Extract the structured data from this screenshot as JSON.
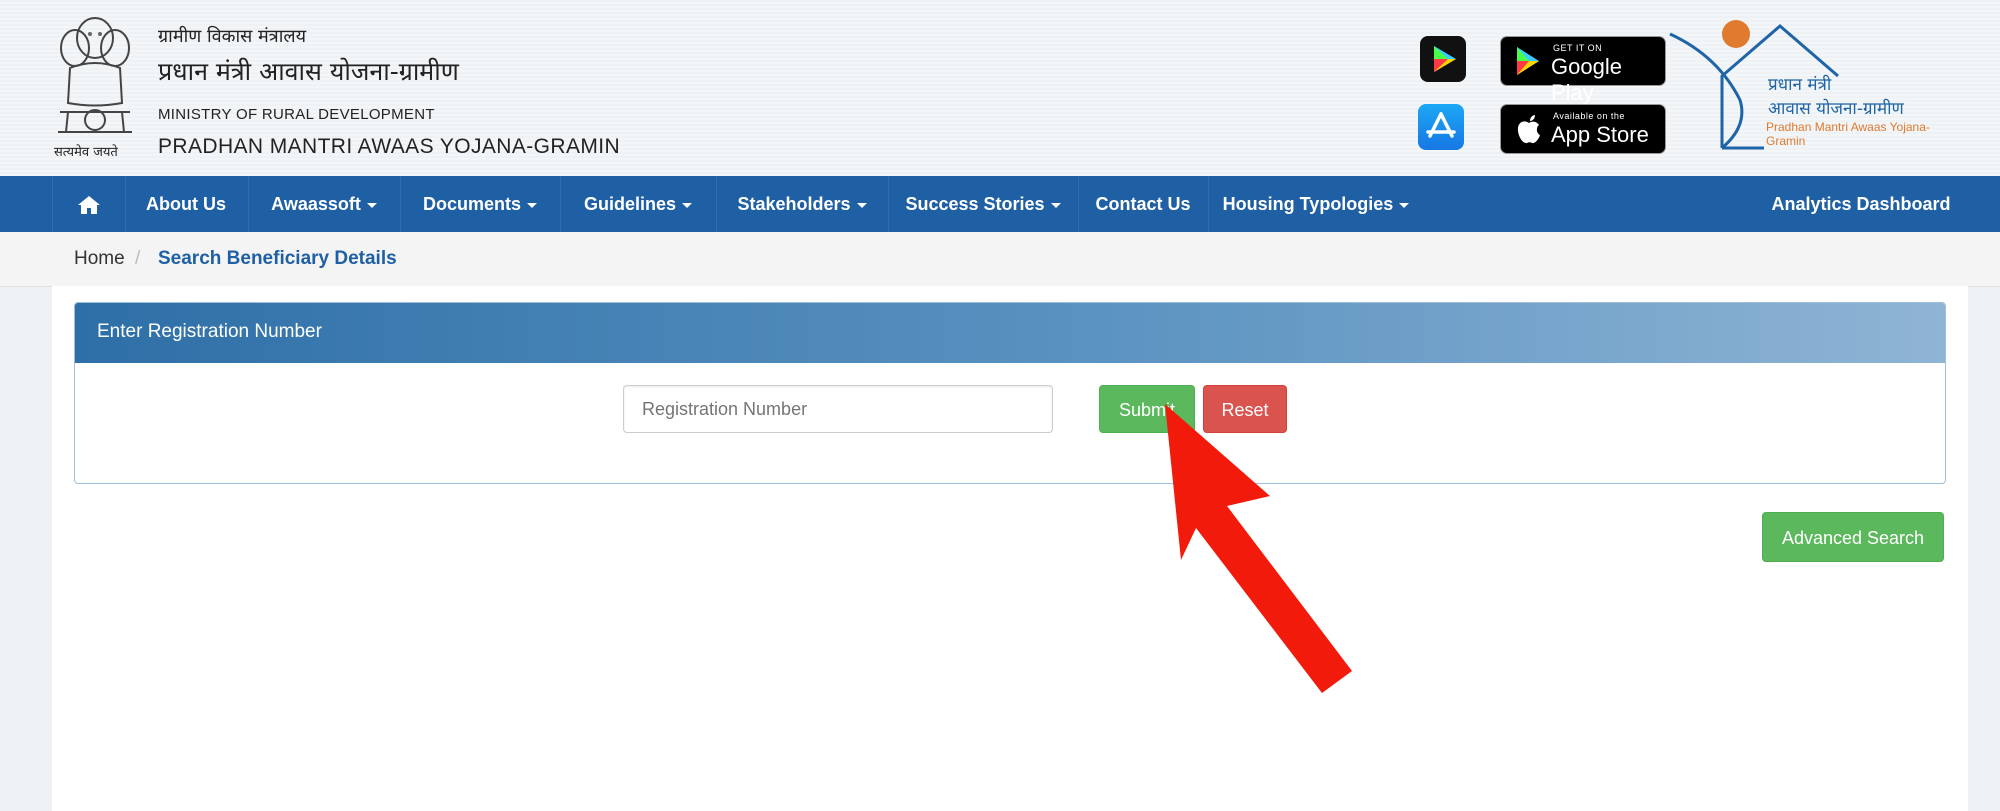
{
  "header": {
    "hindi_ministry": "ग्रामीण विकास मंत्रालय",
    "hindi_scheme": "प्रधान मंत्री आवास योजना-ग्रामीण",
    "ministry": "MINISTRY OF RURAL DEVELOPMENT",
    "scheme": "PRADHAN MANTRI AWAAS YOJANA-GRAMIN",
    "emblem_motto": "सत्यमेव जयते",
    "google_play_small": "GET IT ON",
    "google_play_big": "Google Play",
    "app_store_small": "Available on the",
    "app_store_big": "App Store",
    "logo_line1": "प्रधान मंत्री",
    "logo_line2": "आवास योजना-ग्रामीण",
    "logo_line3": "Pradhan Mantri Awaas Yojana-Gramin"
  },
  "nav": {
    "home_icon": "home-icon",
    "items": [
      {
        "label": "About Us"
      },
      {
        "label": "Awaassoft"
      },
      {
        "label": "Documents"
      },
      {
        "label": "Guidelines"
      },
      {
        "label": "Stakeholders"
      },
      {
        "label": "Success Stories"
      },
      {
        "label": "Contact Us"
      },
      {
        "label": "Housing Typologies"
      }
    ],
    "right": "Analytics Dashboard"
  },
  "breadcrumb": {
    "home": "Home",
    "separator": "/",
    "current": "Search Beneficiary Details"
  },
  "panel": {
    "title": "Enter Registration Number",
    "input_placeholder": "Registration Number",
    "input_value": "",
    "submit": "Submit",
    "reset": "Reset"
  },
  "advanced_search": "Advanced Search",
  "colors": {
    "nav_bg": "#1f5fa4",
    "submit": "#5cb85c",
    "reset": "#d9534f",
    "annotation_arrow": "#f21a0a"
  }
}
